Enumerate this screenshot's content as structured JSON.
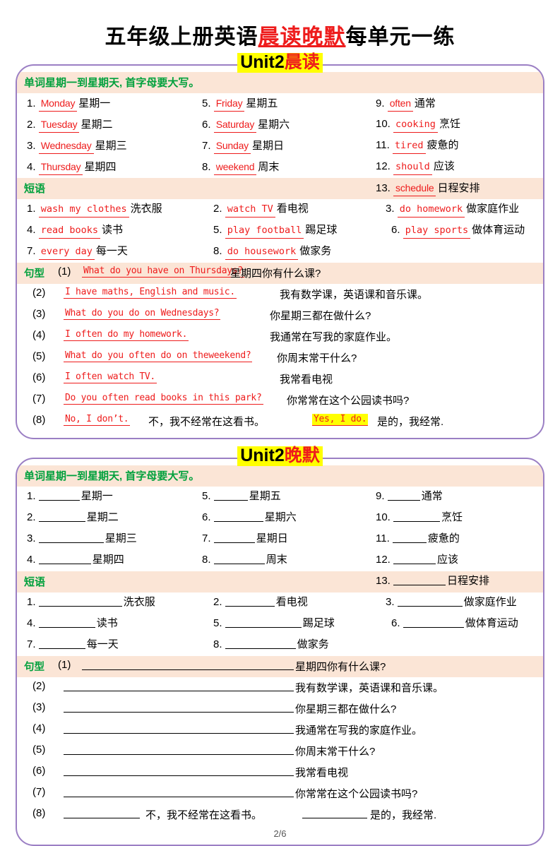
{
  "title": {
    "part1": "五年级上册英语",
    "highlight": "晨读晚默",
    "part2": "每单元一练"
  },
  "banners": {
    "morning": {
      "unit": "Unit2",
      "label": "晨读"
    },
    "evening": {
      "unit": "Unit2",
      "label": "晚默"
    }
  },
  "headers": {
    "words": "单词星期一到星期天, 首字母要大写。",
    "phrases": "短语",
    "sentences": "句型"
  },
  "colors": {
    "border": "#9b7fc4",
    "band": "#fbe5d6",
    "green": "#00a03c",
    "red": "#ee1c1c",
    "highlight": "#ffff00"
  },
  "morning": {
    "words": [
      {
        "n": "1.",
        "en": "Monday",
        "cn": "星期一"
      },
      {
        "n": "2.",
        "en": "Tuesday",
        "cn": "星期二"
      },
      {
        "n": "3.",
        "en": "Wednesday",
        "cn": "星期三"
      },
      {
        "n": "4.",
        "en": "Thursday",
        "cn": "星期四"
      },
      {
        "n": "5.",
        "en": "Friday",
        "cn": "星期五"
      },
      {
        "n": "6.",
        "en": "Saturday",
        "cn": "星期六"
      },
      {
        "n": "7.",
        "en": "Sunday",
        "cn": "星期日"
      },
      {
        "n": "8.",
        "en": "weekend",
        "cn": "周末"
      },
      {
        "n": "9.",
        "en": "often",
        "cn": "通常"
      },
      {
        "n": "10.",
        "en": "cooking",
        "cn": "烹饪"
      },
      {
        "n": "11.",
        "en": "tired",
        "cn": "疲惫的"
      },
      {
        "n": "12.",
        "en": "should",
        "cn": "应该"
      },
      {
        "n": "13.",
        "en": "schedule",
        "cn": "日程安排"
      }
    ],
    "phrases": [
      {
        "n": "1.",
        "en": "wash my clothes",
        "cn": "洗衣服"
      },
      {
        "n": "2.",
        "en": "watch TV",
        "cn": "看电视"
      },
      {
        "n": "3.",
        "en": "do homework",
        "cn": "做家庭作业"
      },
      {
        "n": "4.",
        "en": "read books",
        "cn": "读书"
      },
      {
        "n": "5.",
        "en": "play football",
        "cn": "踢足球"
      },
      {
        "n": "6.",
        "en": "play sports",
        "cn": "做体育运动"
      },
      {
        "n": "7.",
        "en": "every day",
        "cn": "每一天"
      },
      {
        "n": "8.",
        "en": "do housework",
        "cn": "做家务"
      }
    ],
    "sentences": [
      {
        "n": "(1)",
        "en": "What do you have on Thursdays?",
        "cn": "星期四你有什么课?"
      },
      {
        "n": "(2)",
        "en": "I have maths, English and music.",
        "cn": "我有数学课，英语课和音乐课。"
      },
      {
        "n": "(3)",
        "en": "What do you do on Wednesdays?",
        "cn": "你星期三都在做什么?"
      },
      {
        "n": "(4)",
        "en": "I often do my homework.",
        "cn": "我通常在写我的家庭作业。"
      },
      {
        "n": "(5)",
        "en": "What do you often do on theweekend?",
        "cn": "你周末常干什么?"
      },
      {
        "n": "(6)",
        "en": "I often watch TV.",
        "cn": "我常看电视"
      },
      {
        "n": "(7)",
        "en": "Do you often read books in this park?",
        "cn": "你常常在这个公园读书吗?"
      },
      {
        "n": "(8)",
        "en": "No, I don’t.",
        "cn": "不，我不经常在这看书。",
        "en2": "Yes, I do.",
        "cn2": "是的，我经常."
      }
    ]
  },
  "evening": {
    "words": [
      {
        "n": "1.",
        "cn": "星期一"
      },
      {
        "n": "2.",
        "cn": "星期二"
      },
      {
        "n": "3.",
        "cn": "星期三"
      },
      {
        "n": "4.",
        "cn": "星期四"
      },
      {
        "n": "5.",
        "cn": "星期五"
      },
      {
        "n": "6.",
        "cn": "星期六"
      },
      {
        "n": "7.",
        "cn": "星期日"
      },
      {
        "n": "8.",
        "cn": "周末"
      },
      {
        "n": "9.",
        "cn": "通常"
      },
      {
        "n": "10.",
        "cn": "烹饪"
      },
      {
        "n": "11.",
        "cn": "疲惫的"
      },
      {
        "n": "12.",
        "cn": "应该"
      },
      {
        "n": "13.",
        "cn": "日程安排"
      }
    ],
    "phrases": [
      {
        "n": "1.",
        "cn": "洗衣服"
      },
      {
        "n": "2.",
        "cn": "看电视"
      },
      {
        "n": "3.",
        "cn": "做家庭作业"
      },
      {
        "n": "4.",
        "cn": "读书"
      },
      {
        "n": "5.",
        "cn": "踢足球"
      },
      {
        "n": "6.",
        "cn": "做体育运动"
      },
      {
        "n": "7.",
        "cn": "每一天"
      },
      {
        "n": "8.",
        "cn": "做家务"
      }
    ],
    "sentences": [
      {
        "n": "(1)",
        "cn": "星期四你有什么课?"
      },
      {
        "n": "(2)",
        "cn": "我有数学课，英语课和音乐课。"
      },
      {
        "n": "(3)",
        "cn": "你星期三都在做什么?"
      },
      {
        "n": "(4)",
        "cn": "我通常在写我的家庭作业。"
      },
      {
        "n": "(5)",
        "cn": "你周末常干什么?"
      },
      {
        "n": "(6)",
        "cn": "我常看电视"
      },
      {
        "n": "(7)",
        "cn": "你常常在这个公园读书吗?"
      },
      {
        "n": "(8)",
        "cn": "不，我不经常在这看书。",
        "cn2": "是的，我经常."
      }
    ]
  },
  "footer": {
    "page": "2/6"
  }
}
